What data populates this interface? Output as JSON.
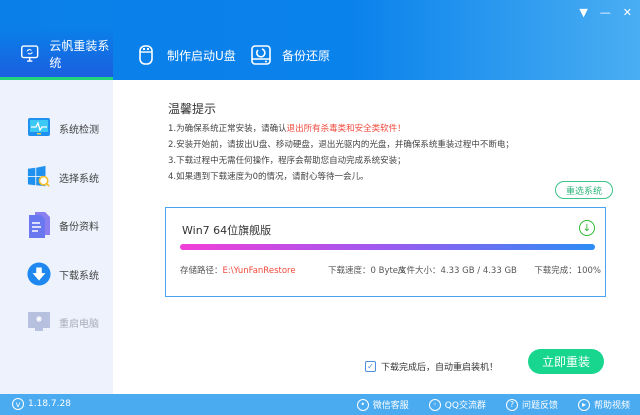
{
  "header": {
    "tabs": [
      {
        "label": "云帆重装系统",
        "icon": "monitor-refresh-icon"
      },
      {
        "label": "制作启动U盘",
        "icon": "usb-drive-icon"
      },
      {
        "label": "备份还原",
        "icon": "disk-restore-icon"
      }
    ],
    "controls": {
      "menu": "▼",
      "minimize": "—",
      "close": "✕"
    }
  },
  "sidebar": {
    "items": [
      {
        "label": "系统检测",
        "icon": "monitor-pulse-icon"
      },
      {
        "label": "选择系统",
        "icon": "windows-search-icon"
      },
      {
        "label": "备份资料",
        "icon": "documents-icon"
      },
      {
        "label": "下载系统",
        "icon": "download-circle-icon"
      },
      {
        "label": "重启电脑",
        "icon": "restart-monitor-icon"
      }
    ]
  },
  "main": {
    "tips_title": "温馨提示",
    "tip1_prefix": "1.为确保系统正常安装，请确认",
    "tip1_highlight": "退出所有杀毒类和安全类软件！",
    "tip2": "2.安装开始前，请拔出U盘、移动硬盘，退出光驱内的光盘，并确保系统重装过程中不断电；",
    "tip3": "3.下载过程中无需任何操作，程序会帮助您自动完成系统安装；",
    "tip4": "4.如果遇到下载速度为0的情况，请耐心等待一会儿。",
    "reselect": "重选系统",
    "card": {
      "title": "Win7 64位旗舰版",
      "progress_percent": 100,
      "path_label": "存储路径：",
      "path_value": "E:\\YunFanRestore",
      "speed": "下载速度：0 Byte/s",
      "size": "文件大小：4.33 GB / 4.33 GB",
      "done": "下载完成：100%"
    },
    "auto_restart": "下载完成后，自动重启装机！",
    "install_button": "立即重装"
  },
  "footer": {
    "version": "1.18.7.28",
    "links": [
      "微信客服",
      "QQ交流群",
      "问题反馈",
      "帮助视频"
    ]
  },
  "colors": {
    "primary": "#0a7fe8",
    "accent_green": "#19d68f",
    "warning": "#f04a3c"
  }
}
